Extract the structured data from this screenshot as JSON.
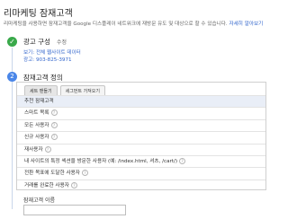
{
  "header": {
    "title": "리마케팅 잠재고객",
    "description": "리마케팅을 사용하면 잠재고객을 Google 디스플레이 네트워크에 재방문 유도 및 대상으로 할 수 있습니다.",
    "more_link": "자세히 알아보기"
  },
  "step1": {
    "title": "광고 구성",
    "edit_label": "수정",
    "line1": "보기: 전체 웹사이트 데이터",
    "line2": "광고: 903-825-3971"
  },
  "step2": {
    "number": "2",
    "title": "잠재고객 정의"
  },
  "tabs": [
    {
      "label": "세트 맨들기"
    },
    {
      "label": "세그먼트 가져오기"
    }
  ],
  "segments": [
    {
      "label": "추천 잠재고객"
    },
    {
      "label": "스마트 목록"
    },
    {
      "label": "모든 사용자"
    },
    {
      "label": "신규 사용자"
    },
    {
      "label": "재사용자"
    },
    {
      "label": "내 사이트의 특정 섹션을 방문한 사용자 (예: /index.html, 셔츠, /cart/)"
    },
    {
      "label": "전환 목표에 도달한 사용자"
    },
    {
      "label": "거래를 완료한 사용자"
    }
  ],
  "name_field": {
    "label": "잠재고객 이름",
    "value": ""
  },
  "colors": {
    "check": "#39a94a",
    "step": "#4a86e8",
    "link": "#3366cc"
  }
}
